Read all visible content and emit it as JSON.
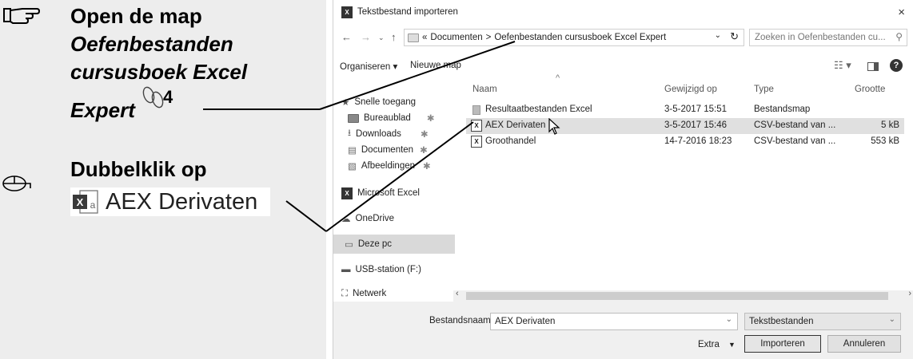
{
  "instructions": {
    "step1_line1": "Open de map",
    "step1_line2": "Oefenbestanden",
    "step1_line3": "cursusboek Excel",
    "step1_line4": "Expert",
    "step1_ref": "4",
    "step2_line1": "Dubbelklik op",
    "tile_label": "AEX Derivaten"
  },
  "dialog": {
    "title": "Tekstbestand importeren",
    "close": "×",
    "breadcrumb_prefix": "«",
    "breadcrumb_1": "Documenten",
    "breadcrumb_sep": ">",
    "breadcrumb_2": "Oefenbestanden cursusboek Excel Expert",
    "search_placeholder": "Zoeken in Oefenbestanden cu...",
    "organize": "Organiseren ▾",
    "new_folder": "Nieuwe map",
    "help": "?",
    "nav_items": [
      {
        "label": "Snelle toegang"
      },
      {
        "label": "Bureaublad"
      },
      {
        "label": "Downloads"
      },
      {
        "label": "Documenten"
      },
      {
        "label": "Afbeeldingen"
      },
      {
        "label": "Microsoft Excel"
      },
      {
        "label": "OneDrive"
      },
      {
        "label": "Deze pc"
      },
      {
        "label": "USB-station (F:)"
      },
      {
        "label": "Netwerk"
      }
    ],
    "columns": {
      "name": "Naam",
      "modified": "Gewijzigd op",
      "type": "Type",
      "size": "Grootte"
    },
    "files": [
      {
        "name": "Resultaatbestanden Excel",
        "modified": "3-5-2017 15:51",
        "type": "Bestandsmap",
        "size": ""
      },
      {
        "name": "AEX Derivaten",
        "modified": "3-5-2017 15:46",
        "type": "CSV-bestand van ...",
        "size": "5 kB"
      },
      {
        "name": "Groothandel",
        "modified": "14-7-2016 18:23",
        "type": "CSV-bestand van ...",
        "size": "553 kB"
      }
    ],
    "filename_label": "Bestandsnaam:",
    "filename_value": "AEX Derivaten",
    "filter_value": "Tekstbestanden",
    "extra": "Extra",
    "import_btn": "Importeren",
    "cancel_btn": "Annuleren"
  }
}
